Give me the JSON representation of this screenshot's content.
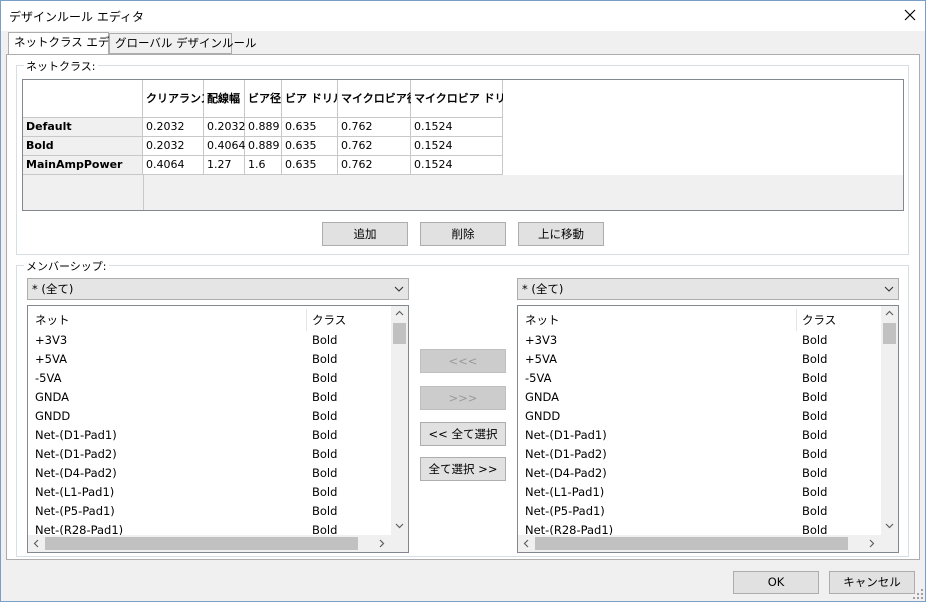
{
  "window": {
    "title": "デザインルール エディタ"
  },
  "tabs": [
    {
      "label": "ネットクラス エディタ",
      "active": true
    },
    {
      "label": "グローバル デザインルール",
      "active": false
    }
  ],
  "netclasses": {
    "legend": "ネットクラス:",
    "columns": [
      "クリアランス",
      "配線幅",
      "ビア径",
      "ビア ドリル",
      "マイクロビア径",
      "マイクロビア ドリル"
    ],
    "rows": [
      {
        "name": "Default",
        "values": [
          "0.2032",
          "0.2032",
          "0.889",
          "0.635",
          "0.762",
          "0.1524"
        ]
      },
      {
        "name": "Bold",
        "values": [
          "0.2032",
          "0.4064",
          "0.889",
          "0.635",
          "0.762",
          "0.1524"
        ]
      },
      {
        "name": "MainAmpPower",
        "values": [
          "0.4064",
          "1.27",
          "1.6",
          "0.635",
          "0.762",
          "0.1524"
        ]
      }
    ],
    "buttons": {
      "add": "追加",
      "delete": "削除",
      "move_up": "上に移動"
    }
  },
  "membership": {
    "legend": "メンバーシップ:",
    "left_filter": "* (全て)",
    "right_filter": "* (全て)",
    "list_headers": {
      "net": "ネット",
      "class": "クラス"
    },
    "nets": [
      {
        "net": "+3V3",
        "class": "Bold"
      },
      {
        "net": "+5VA",
        "class": "Bold"
      },
      {
        "net": "-5VA",
        "class": "Bold"
      },
      {
        "net": "GNDA",
        "class": "Bold"
      },
      {
        "net": "GNDD",
        "class": "Bold"
      },
      {
        "net": "Net-(D1-Pad1)",
        "class": "Bold"
      },
      {
        "net": "Net-(D1-Pad2)",
        "class": "Bold"
      },
      {
        "net": "Net-(D4-Pad2)",
        "class": "Bold"
      },
      {
        "net": "Net-(L1-Pad1)",
        "class": "Bold"
      },
      {
        "net": "Net-(P5-Pad1)",
        "class": "Bold"
      },
      {
        "net": "Net-(R28-Pad1)",
        "class": "Bold"
      }
    ],
    "buttons": {
      "move_left": "<<<",
      "move_right": ">>>",
      "select_all_left": "<< 全て選択",
      "select_all_right": "全て選択 >>"
    }
  },
  "footer": {
    "ok": "OK",
    "cancel": "キャンセル"
  }
}
